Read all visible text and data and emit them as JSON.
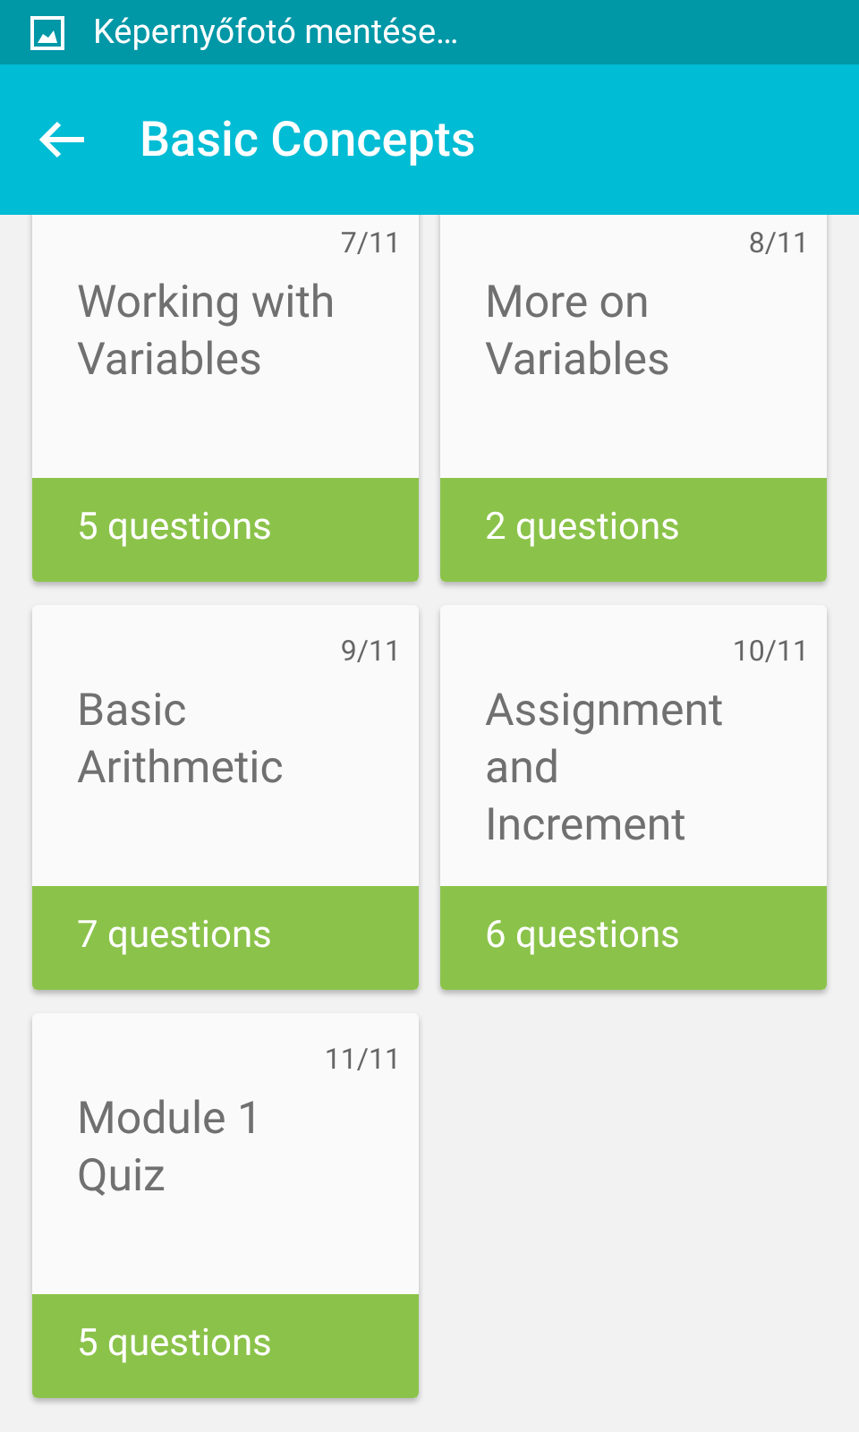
{
  "status_bar": {
    "notification": "Képernyőfotó mentése…"
  },
  "app_bar": {
    "title": "Basic Concepts"
  },
  "lessons": [
    {
      "number": "7/11",
      "title": "Working with Variables",
      "questions": "5 questions"
    },
    {
      "number": "8/11",
      "title": "More on Variables",
      "questions": "2 questions"
    },
    {
      "number": "9/11",
      "title": "Basic Arithmetic",
      "questions": "7 questions"
    },
    {
      "number": "10/11",
      "title": "Assignment and Increment",
      "questions": "6 questions"
    },
    {
      "number": "11/11",
      "title": "Module 1 Quiz",
      "questions": "5 questions"
    }
  ]
}
